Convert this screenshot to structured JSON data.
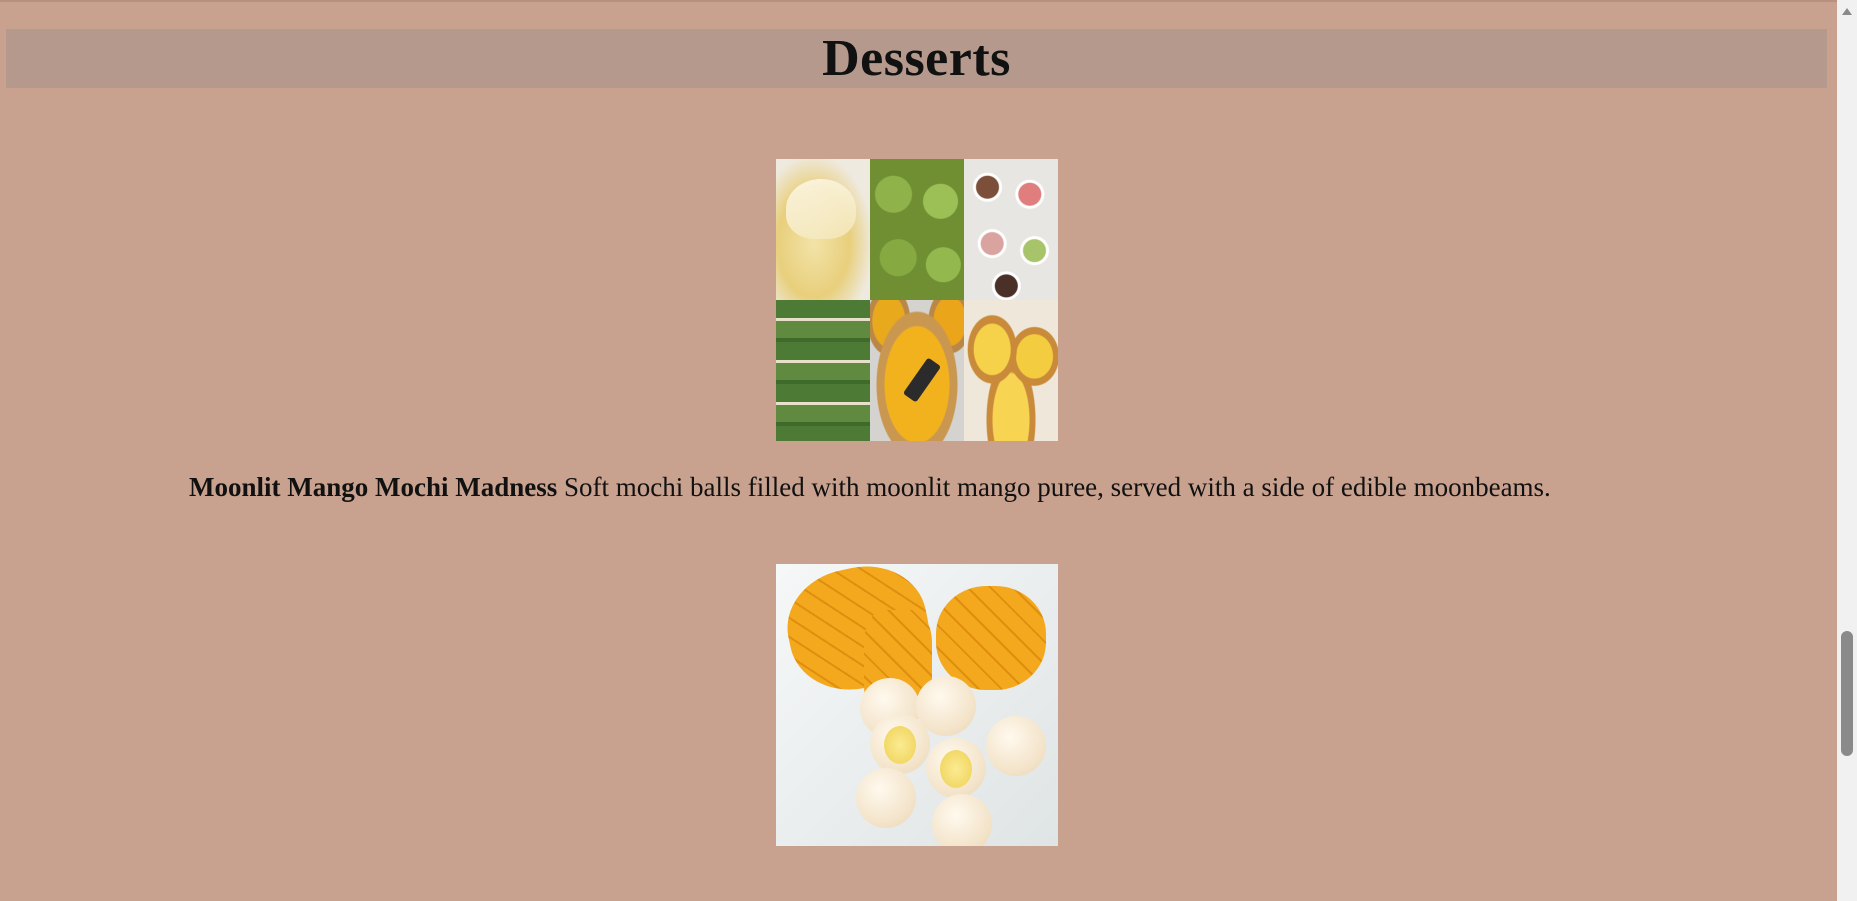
{
  "page": {
    "heading": "Desserts",
    "background_color": "#c8a18f",
    "header_band_color": "#b5998d"
  },
  "gallery": {
    "image_alt": "Assorted desserts collage"
  },
  "dessert_item": {
    "name": "Moonlit Mango Mochi Madness",
    "description": "Soft mochi balls filled with moonlit mango puree, served with a side of edible moonbeams.",
    "image_alt": "Mango mochi with sliced mango"
  },
  "scrollbar": {
    "up_icon": "arrow-up-icon"
  }
}
